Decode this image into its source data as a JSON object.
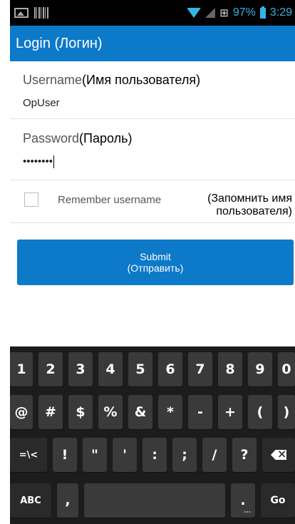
{
  "status_bar": {
    "battery_percent": "97%",
    "time": "3:29",
    "icons": [
      "image-icon",
      "barcode-icon",
      "wifi-icon",
      "signal-icon",
      "network-icon",
      "battery-icon"
    ]
  },
  "title_bar": {
    "title": "Login (Логин)"
  },
  "form": {
    "username_label": "Username",
    "username_label_ru": "(Имя пользователя)",
    "username_value": "OpUser",
    "password_label": "Password",
    "password_label_ru": "(Пароль)",
    "password_value": "••••••••",
    "remember_label": "Remember username",
    "remember_label_ru": "(Запомнить имя пользователя)",
    "remember_checked": false,
    "submit_label": "Submit",
    "submit_label_ru": "(Отправить)"
  },
  "keyboard": {
    "row1": [
      "1",
      "2",
      "3",
      "4",
      "5",
      "6",
      "7",
      "8",
      "9",
      "0"
    ],
    "row2": [
      "@",
      "#",
      "$",
      "%",
      "&",
      "*",
      "-",
      "+",
      "(",
      ")"
    ],
    "row3": [
      "=\\<",
      "!",
      "\"",
      "'",
      ":",
      ";",
      "/",
      "?"
    ],
    "row4": {
      "abc": "ABC",
      "comma": ",",
      "period": ".",
      "go": "Go"
    }
  },
  "colors": {
    "accent": "#0d79c9",
    "status_accent": "#33b5e5",
    "keyboard_bg": "#1c1c1c",
    "key_bg": "#3a3a3a"
  }
}
